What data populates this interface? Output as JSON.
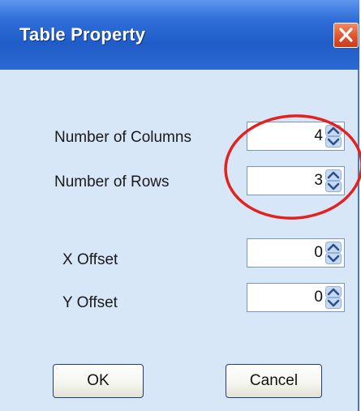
{
  "window": {
    "title": "Table Property"
  },
  "fields": [
    {
      "label": "Number of Columns",
      "value": "4"
    },
    {
      "label": "Number of Rows",
      "value": "3"
    },
    {
      "label": "X Offset",
      "value": "0"
    },
    {
      "label": "Y Offset",
      "value": "0"
    }
  ],
  "buttons": {
    "ok_label": "OK",
    "cancel_label": "Cancel"
  },
  "icons": {
    "close": "close-icon",
    "spin_up": "spin-up-arrow-icon",
    "spin_down": "spin-down-arrow-icon"
  },
  "colors": {
    "titlebar": "#2563d6",
    "dialog_background": "#d8e7f8",
    "close_button": "#e0542e",
    "annotation_circle": "#e3211e"
  }
}
